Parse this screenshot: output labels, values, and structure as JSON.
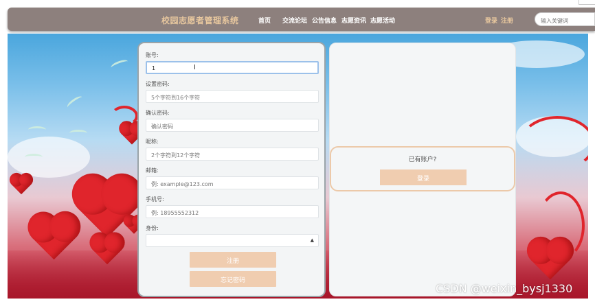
{
  "header": {
    "site_title": "校园志愿者管理系统",
    "nav": [
      "首页",
      "交流论坛",
      "公告信息",
      "志愿资讯",
      "志愿活动"
    ],
    "login_link": "登录",
    "register_link": "注册",
    "search_placeholder": "输入关键词"
  },
  "form": {
    "account": {
      "label": "账号:",
      "value": "1"
    },
    "password": {
      "label": "设置密码:",
      "placeholder": "5个字符到16个字符"
    },
    "confirm": {
      "label": "确认密码:",
      "placeholder": "确认密码"
    },
    "nickname": {
      "label": "昵称:",
      "placeholder": "2个字符到12个字符"
    },
    "email": {
      "label": "邮箱:",
      "placeholder": "例: example@123.com"
    },
    "phone": {
      "label": "手机号:",
      "placeholder": "例: 18955552312"
    },
    "identity": {
      "label": "身份:",
      "selected": ""
    },
    "register_button": "注册",
    "forgot_button": "忘记密码"
  },
  "side": {
    "have_account": "已有账户?",
    "login_button": "登录"
  },
  "watermark": "CSDN @weixin_bysj1330",
  "colors": {
    "navbar": "#8d807d",
    "accent": "#e8c79e",
    "button": "#f0cdb0"
  }
}
